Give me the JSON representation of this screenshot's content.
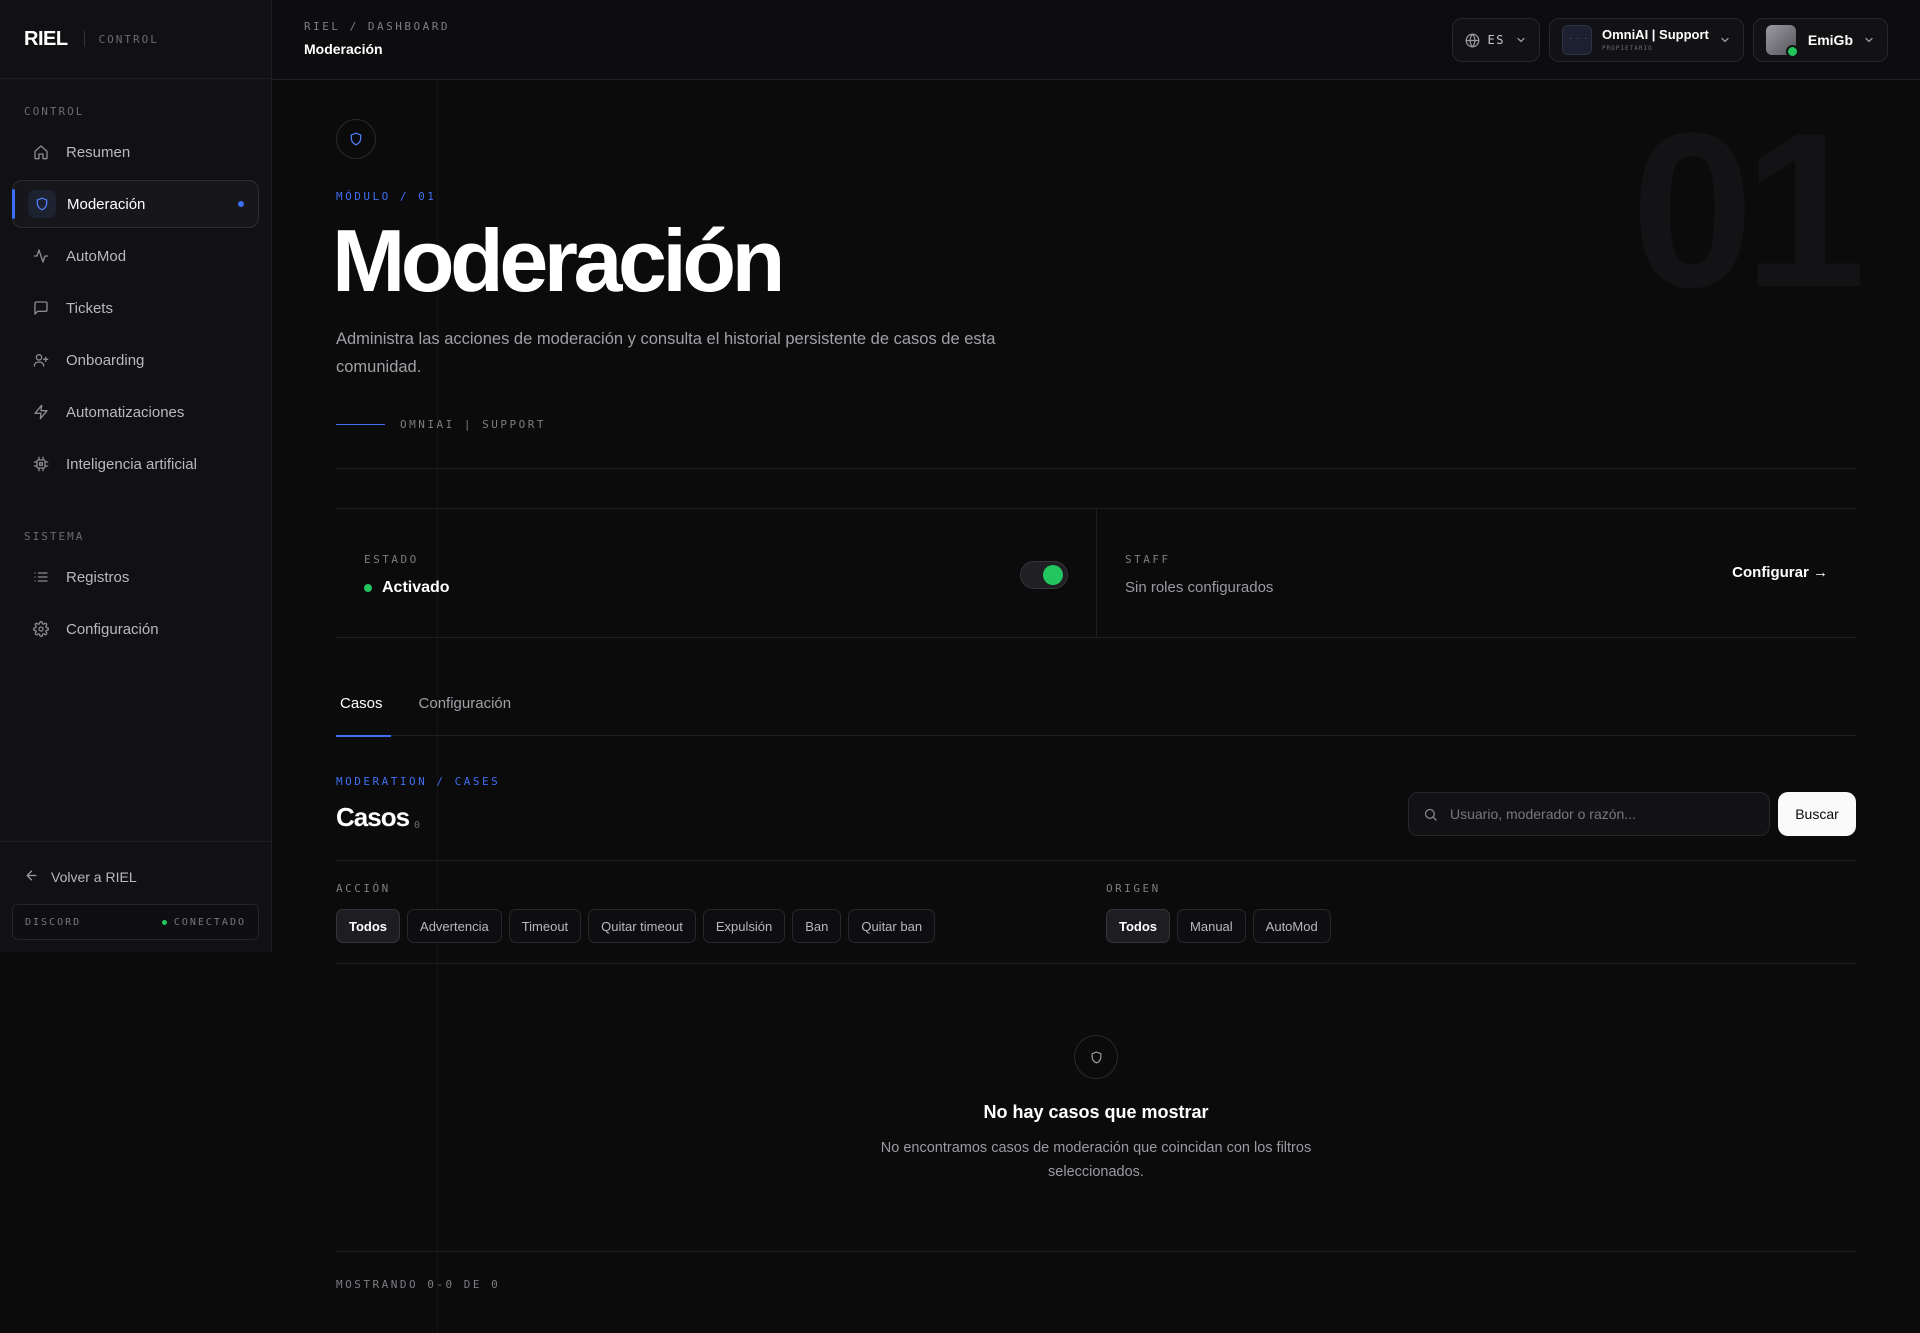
{
  "sidebar": {
    "brand": "RIEL",
    "brand_sub": "CONTROL",
    "section_control": "CONTROL",
    "section_system": "SISTEMA",
    "items": [
      {
        "label": "Resumen",
        "icon": "home-icon"
      },
      {
        "label": "Moderación",
        "icon": "shield-icon",
        "active": true
      },
      {
        "label": "AutoMod",
        "icon": "activity-icon"
      },
      {
        "label": "Tickets",
        "icon": "message-icon"
      },
      {
        "label": "Onboarding",
        "icon": "user-plus-icon"
      },
      {
        "label": "Automatizaciones",
        "icon": "bolt-icon"
      },
      {
        "label": "Inteligencia artificial",
        "icon": "chip-icon"
      }
    ],
    "system_items": [
      {
        "label": "Registros",
        "icon": "list-icon"
      },
      {
        "label": "Configuración",
        "icon": "gear-icon"
      }
    ],
    "back_label": "Volver a RIEL",
    "status_service": "DISCORD",
    "status_state": "CONECTADO"
  },
  "topbar": {
    "breadcrumb": "RIEL / DASHBOARD",
    "title": "Moderación",
    "language": "ES",
    "server_name": "OmniAI | Support",
    "server_role": "PROPIETARIO",
    "user_name": "EmiGb"
  },
  "module": {
    "eyebrow": "MÓDULO / 01",
    "big_number": "01",
    "title": "Moderación",
    "description": "Administra las acciones de moderación y consulta el historial persistente de casos de esta comunidad.",
    "guild": "OMNIAI | SUPPORT"
  },
  "status": {
    "state_label": "ESTADO",
    "state_value": "Activado",
    "toggle_on": true,
    "staff_label": "STAFF",
    "staff_value": "Sin roles configurados",
    "configure_label": "Configurar →"
  },
  "tabs": [
    "Casos",
    "Configuración"
  ],
  "cases": {
    "eyebrow": "MODERATION / CASES",
    "title": "Casos",
    "count": "0",
    "search_placeholder": "Usuario, moderador o razón...",
    "search_button": "Buscar",
    "action_label": "ACCIÓN",
    "action_filters": [
      "Todos",
      "Advertencia",
      "Timeout",
      "Quitar timeout",
      "Expulsión",
      "Ban",
      "Quitar ban"
    ],
    "origin_label": "ORIGEN",
    "origin_filters": [
      "Todos",
      "Manual",
      "AutoMod"
    ],
    "empty_title": "No hay casos que mostrar",
    "empty_desc": "No encontramos casos de moderación que coincidan con los filtros seleccionados.",
    "footer": "MOSTRANDO 0-0 DE 0"
  },
  "colors": {
    "accent": "#3b6ef5",
    "success": "#22c55e",
    "background": "#0b0b0c"
  }
}
